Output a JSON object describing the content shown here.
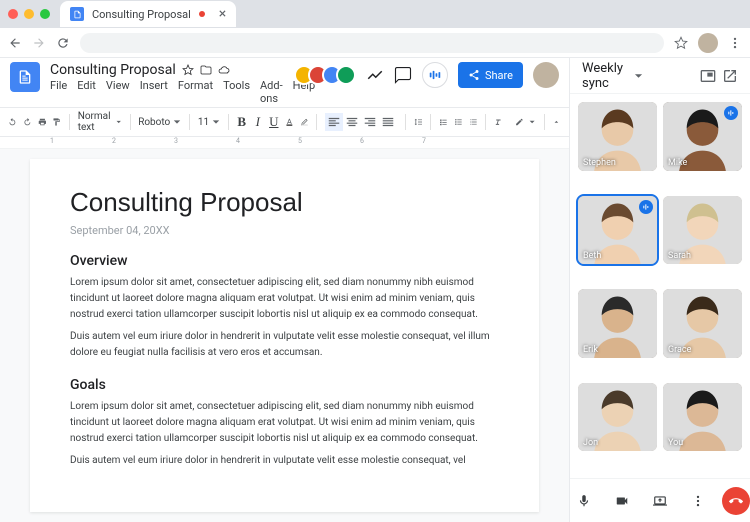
{
  "browser": {
    "tab_title": "Consulting Proposal",
    "tab_unsaved": true
  },
  "docs": {
    "title": "Consulting Proposal",
    "menus": [
      "File",
      "Edit",
      "View",
      "Insert",
      "Format",
      "Tools",
      "Add-ons",
      "Help"
    ],
    "toolbar": {
      "style": "Normal text",
      "font": "Roboto",
      "size": "11"
    },
    "share_label": "Share"
  },
  "document": {
    "heading": "Consulting Proposal",
    "date": "September 04, 20XX",
    "section1_title": "Overview",
    "section1_p1": "Lorem ipsum dolor sit amet, consectetuer adipiscing elit, sed diam nonummy nibh euismod tincidunt ut laoreet dolore magna aliquam erat volutpat. Ut wisi enim ad minim veniam, quis nostrud exerci tation ullamcorper suscipit lobortis nisl ut aliquip ex ea commodo consequat.",
    "section1_p2": "Duis autem vel eum iriure dolor in hendrerit in vulputate velit esse molestie consequat, vel illum dolore eu feugiat nulla facilisis at vero eros et accumsan.",
    "section2_title": "Goals",
    "section2_p1": "Lorem ipsum dolor sit amet, consectetuer adipiscing elit, sed diam nonummy nibh euismod tincidunt ut laoreet dolore magna aliquam erat volutpat. Ut wisi enim ad minim veniam, quis nostrud exerci tation ullamcorper suscipit lobortis nisl ut aliquip ex ea commodo consequat.",
    "section2_p2": "Duis autem vel eum iriure dolor in hendrerit in vulputate velit esse molestie consequat, vel"
  },
  "meet": {
    "title": "Weekly sync",
    "participants": [
      {
        "name": "Stephen",
        "speaking": false,
        "active": false,
        "bg": "#9b8b7a"
      },
      {
        "name": "Mike",
        "speaking": true,
        "active": false,
        "bg": "#6b5a4a"
      },
      {
        "name": "Beth",
        "speaking": true,
        "active": true,
        "bg": "#a89888"
      },
      {
        "name": "Sarah",
        "speaking": false,
        "active": false,
        "bg": "#b8a898"
      },
      {
        "name": "Erik",
        "speaking": false,
        "active": false,
        "bg": "#8a7a6a"
      },
      {
        "name": "Grace",
        "speaking": false,
        "active": false,
        "bg": "#9a8a7a"
      },
      {
        "name": "Jon",
        "speaking": false,
        "active": false,
        "bg": "#b0a090"
      },
      {
        "name": "You",
        "speaking": false,
        "active": false,
        "bg": "#988878"
      }
    ]
  },
  "ruler_labels": [
    "1",
    "2",
    "3",
    "4",
    "5",
    "6",
    "7"
  ]
}
